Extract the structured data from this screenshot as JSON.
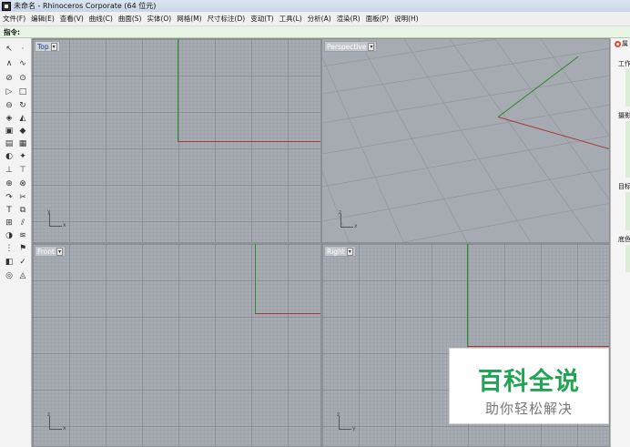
{
  "window": {
    "title": "未命名 - Rhinoceros Corporate (64 位元)"
  },
  "menu": [
    "文件(F)",
    "编辑(E)",
    "查看(V)",
    "曲线(C)",
    "曲面(S)",
    "实体(O)",
    "网格(M)",
    "尺寸标注(D)",
    "变动(T)",
    "工具(L)",
    "分析(A)",
    "渲染(R)",
    "面板(P)",
    "说明(H)"
  ],
  "command": {
    "label": "指令:",
    "value": ""
  },
  "viewports": {
    "top": {
      "label": "Top",
      "gizmo_y": "y",
      "gizmo_x": "x"
    },
    "perspective": {
      "label": "Perspective",
      "gizmo_y": "z",
      "gizmo_x": "x"
    },
    "front": {
      "label": "Front",
      "gizmo_y": "z",
      "gizmo_x": "x"
    },
    "right": {
      "label": "Right",
      "gizmo_y": "z",
      "gizmo_x": "y"
    }
  },
  "panel": {
    "head": "属",
    "sections": [
      "工作",
      "摄影",
      "目标",
      "底色"
    ]
  },
  "watermark": {
    "main": "百科全说",
    "sub": "助你轻松解决"
  },
  "colors": {
    "x_axis": "#a33a3a",
    "y_axis": "#2e8a2e",
    "viewport_bg": "#a6abb1",
    "command_bg": "#e8f4e4",
    "watermark_green": "#23a455"
  }
}
